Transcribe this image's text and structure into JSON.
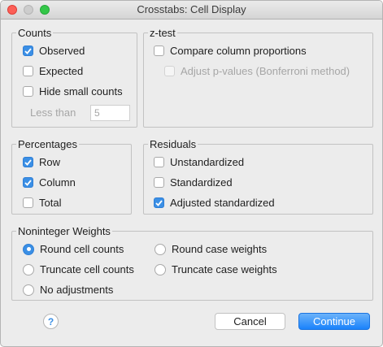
{
  "window": {
    "title": "Crosstabs: Cell Display"
  },
  "counts": {
    "title": "Counts",
    "observed": {
      "label": "Observed",
      "checked": true
    },
    "expected": {
      "label": "Expected",
      "checked": false
    },
    "hide_small": {
      "label": "Hide small counts",
      "checked": false
    },
    "less_than_label": "Less than",
    "less_than_value": "5"
  },
  "ztest": {
    "title": "z-test",
    "compare": {
      "label": "Compare column proportions",
      "checked": false
    },
    "adjust": {
      "label": "Adjust p-values (Bonferroni method)",
      "checked": false,
      "enabled": false
    }
  },
  "percentages": {
    "title": "Percentages",
    "row": {
      "label": "Row",
      "checked": true
    },
    "column": {
      "label": "Column",
      "checked": true
    },
    "total": {
      "label": "Total",
      "checked": false
    }
  },
  "residuals": {
    "title": "Residuals",
    "unstandardized": {
      "label": "Unstandardized",
      "checked": false
    },
    "standardized": {
      "label": "Standardized",
      "checked": false
    },
    "adjusted": {
      "label": "Adjusted standardized",
      "checked": true
    }
  },
  "weights": {
    "title": "Noninteger Weights",
    "round_cell": {
      "label": "Round cell counts",
      "selected": true
    },
    "round_case": {
      "label": "Round case weights",
      "selected": false
    },
    "truncate_cell": {
      "label": "Truncate cell counts",
      "selected": false
    },
    "truncate_case": {
      "label": "Truncate case weights",
      "selected": false
    },
    "no_adjust": {
      "label": "No adjustments",
      "selected": false
    }
  },
  "buttons": {
    "help": "?",
    "cancel": "Cancel",
    "continue": "Continue"
  },
  "colors": {
    "accent": "#3b8fe5",
    "window_bg": "#ececec",
    "disabled_text": "#a6a6a6"
  }
}
